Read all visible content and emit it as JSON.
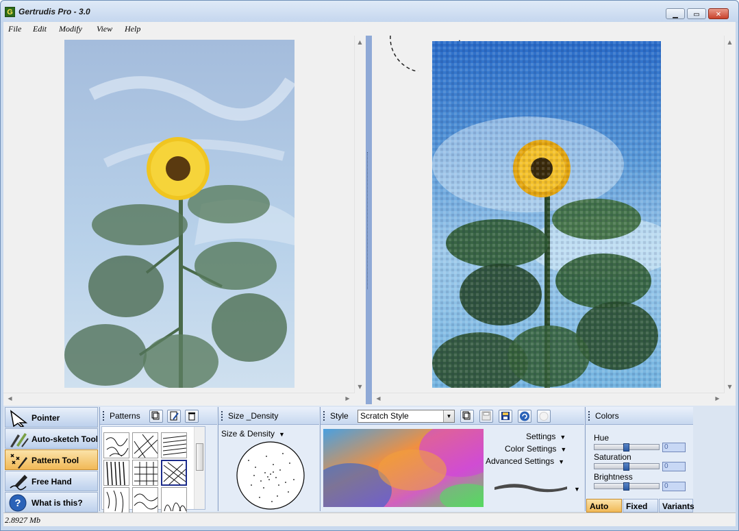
{
  "window": {
    "title": "Gertrudis Pro - 3.0",
    "icon_letter": "G",
    "controls": [
      "minimize-icon",
      "maximize-icon",
      "close-icon"
    ]
  },
  "menu": {
    "items": [
      {
        "label": "File"
      },
      {
        "label": "Edit"
      },
      {
        "label": "Modify"
      },
      {
        "label": "View"
      },
      {
        "label": "Help"
      }
    ]
  },
  "canvas": {
    "left_image": "sunflower photo (original)",
    "right_image": "sunflower painting (rendered)"
  },
  "tools": {
    "items": [
      {
        "label": "Pointer",
        "icon": "pointer-arrow-icon",
        "active": false
      },
      {
        "label": "Auto-sketch Tool",
        "icon": "auto-sketch-icon",
        "active": false
      },
      {
        "label": "Pattern Tool",
        "icon": "pattern-tool-icon",
        "active": true
      },
      {
        "label": "Free Hand",
        "icon": "free-hand-pen-icon",
        "active": false
      },
      {
        "label": "What is this?",
        "icon": "help-question-icon",
        "active": false
      }
    ]
  },
  "patterns": {
    "title": "Patterns",
    "buttons": [
      "copy-pattern-icon",
      "edit-pattern-icon",
      "delete-pattern-icon"
    ]
  },
  "size_density": {
    "title": "Size _Density",
    "dropdown_label": "Size & Density"
  },
  "style": {
    "title": "Style",
    "selected": "Scratch Style",
    "buttons": [
      "new-style-icon",
      "save-style-icon",
      "save-as-style-icon",
      "refresh-style-icon",
      "disabled-style-icon"
    ],
    "menus": [
      {
        "label": "Settings"
      },
      {
        "label": "Color Settings"
      },
      {
        "label": "Advanced Settings"
      }
    ]
  },
  "colors": {
    "title": "Colors",
    "sliders": [
      {
        "label": "Hue",
        "value": "0",
        "level": 0.5
      },
      {
        "label": "Saturation",
        "value": "0",
        "level": 0.5
      },
      {
        "label": "Brightness",
        "value": "0",
        "level": 0.5
      }
    ],
    "tabs": [
      {
        "label": "Auto",
        "active": true
      },
      {
        "label": "Fixed",
        "active": false
      },
      {
        "label": "Variants",
        "active": false
      }
    ]
  },
  "status": {
    "memory": "2.8927 Mb"
  }
}
